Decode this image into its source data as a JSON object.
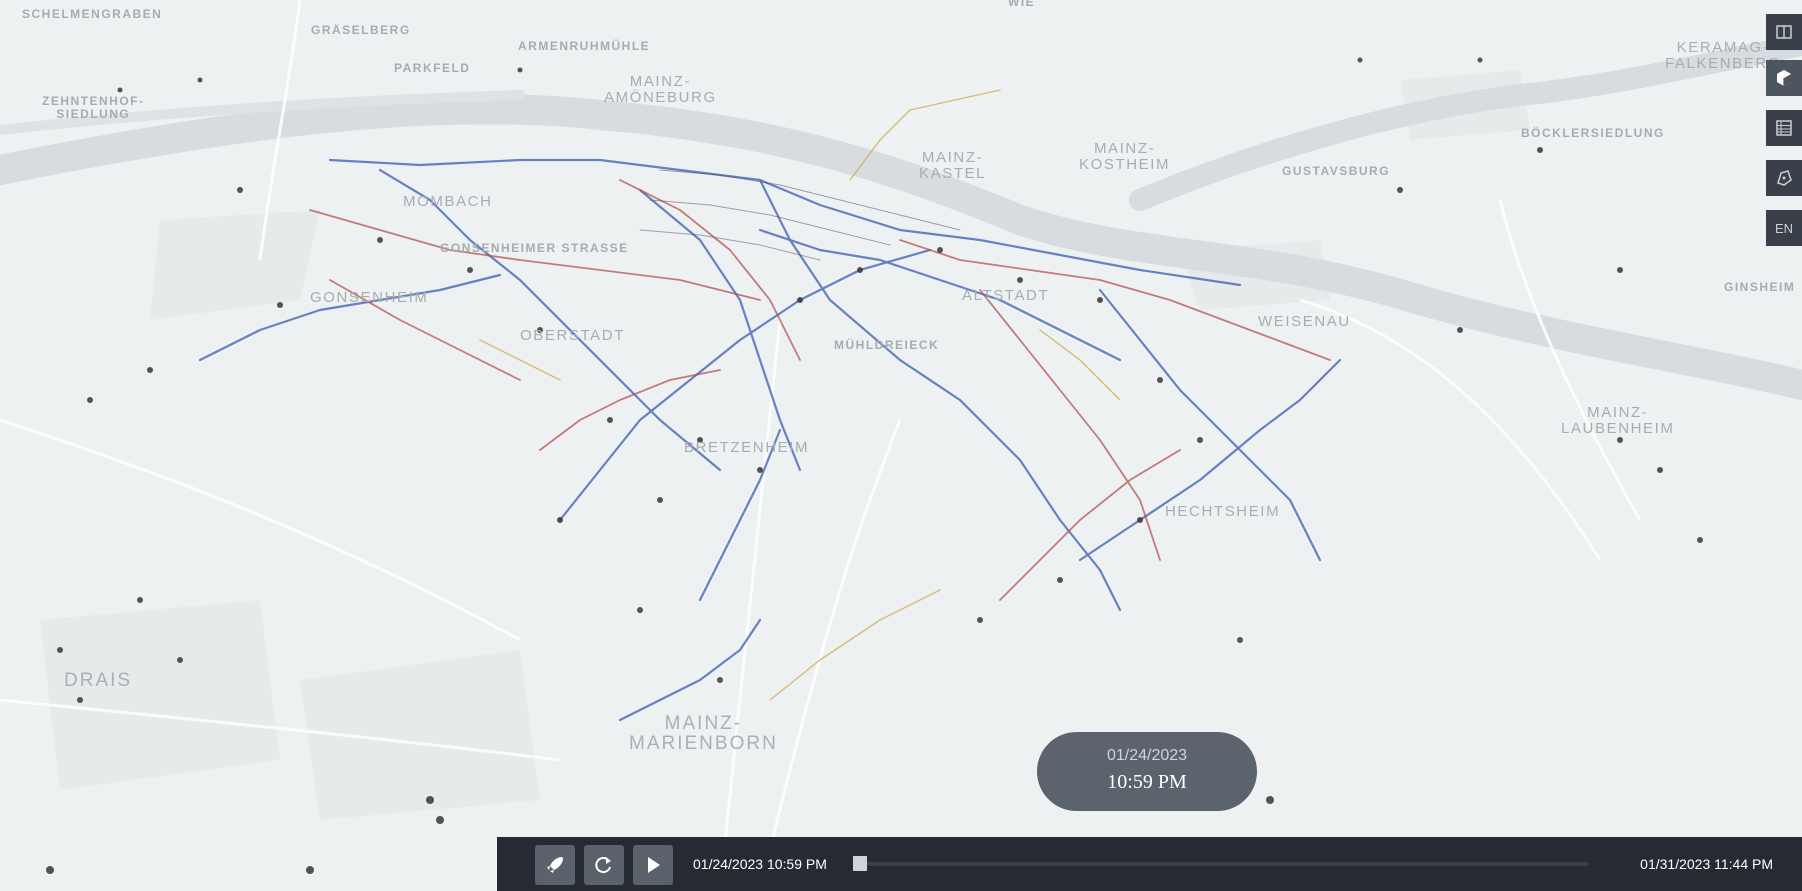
{
  "map": {
    "places": [
      {
        "name": "Schelmengraben",
        "label": "SCHELMENGRABEN",
        "size": "sm"
      },
      {
        "name": "Gräselberg",
        "label": "GRÄSELBERG",
        "size": "sm"
      },
      {
        "name": "Armenruhmühle",
        "label": "ARMENRUHMÜHLE",
        "size": "sm"
      },
      {
        "name": "Wie",
        "label": "WIE",
        "size": "sm"
      },
      {
        "name": "Parkfeld",
        "label": "PARKFELD",
        "size": "sm"
      },
      {
        "name": "Mainz-Amöneburg",
        "label": "MAINZ-\nAMÖNEBURG",
        "size": "md"
      },
      {
        "name": "Zehntenhof-Siedlung",
        "label": "ZEHNTENHOF-\nSIEDLUNG",
        "size": "sm"
      },
      {
        "name": "Keramag-Falkenberg",
        "label": "KERAMAG-\nFALKENBERG",
        "size": "md"
      },
      {
        "name": "Mainz-Kastel",
        "label": "MAINZ-\nKASTEL",
        "size": "md"
      },
      {
        "name": "Mainz-Kostheim",
        "label": "MAINZ-\nKOSTHEIM",
        "size": "md"
      },
      {
        "name": "Böcklersiedlung",
        "label": "BÖCKLERSIEDLUNG",
        "size": "sm"
      },
      {
        "name": "Gustavsburg",
        "label": "GUSTAVSBURG",
        "size": "sm"
      },
      {
        "name": "Mombach",
        "label": "MOMBACH",
        "size": "md"
      },
      {
        "name": "Gonsenheimer Strasse",
        "label": "GONSENHEIMER STRASSE",
        "size": "sm"
      },
      {
        "name": "Ginsheim",
        "label": "GINSHEIM",
        "size": "sm"
      },
      {
        "name": "Gonsenheim",
        "label": "GONSENHEIM",
        "size": "md"
      },
      {
        "name": "Altstadt",
        "label": "ALTSTADT",
        "size": "md"
      },
      {
        "name": "Weisenau",
        "label": "WEISENAU",
        "size": "md"
      },
      {
        "name": "Mühldreieck",
        "label": "MÜHLDREIECK",
        "size": "sm"
      },
      {
        "name": "Oberstadt",
        "label": "OBERSTADT",
        "size": "md"
      },
      {
        "name": "Bretzenheim",
        "label": "BRETZENHEIM",
        "size": "md"
      },
      {
        "name": "Mainz-Laubenheim",
        "label": "MAINZ-\nLAUBENHEIM",
        "size": "md"
      },
      {
        "name": "Hechtsheim",
        "label": "HECHTSHEIM",
        "size": "md"
      },
      {
        "name": "Drais",
        "label": "DRAIS",
        "size": "lg"
      },
      {
        "name": "Mainz-Marienborn",
        "label": "MAINZ-\nMARIENBORN",
        "size": "lg"
      }
    ]
  },
  "sidebar": {
    "buttons": [
      {
        "name": "panel-toggle-button",
        "icon": "panel-icon"
      },
      {
        "name": "view-3d-button",
        "icon": "cube-icon"
      },
      {
        "name": "table-button",
        "icon": "table-icon"
      },
      {
        "name": "map-area-button",
        "icon": "map-area-icon"
      }
    ],
    "lang_label": "EN"
  },
  "time_bubble": {
    "date": "01/24/2023",
    "time": "10:59 PM"
  },
  "playbar": {
    "start_label": "01/24/2023 10:59 PM",
    "end_label": "01/31/2023 11:44 PM",
    "progress": 0.0,
    "buttons": {
      "launch": "rocket-icon",
      "reset": "reset-icon",
      "play": "play-icon"
    }
  },
  "colors": {
    "background": "#eef1f1",
    "river": "#d8dee1",
    "panel": "#252a33",
    "button": "#5a626c",
    "route_blue": "#3a5bb5",
    "route_red": "#b04a48",
    "route_gold": "#c9a43a"
  }
}
